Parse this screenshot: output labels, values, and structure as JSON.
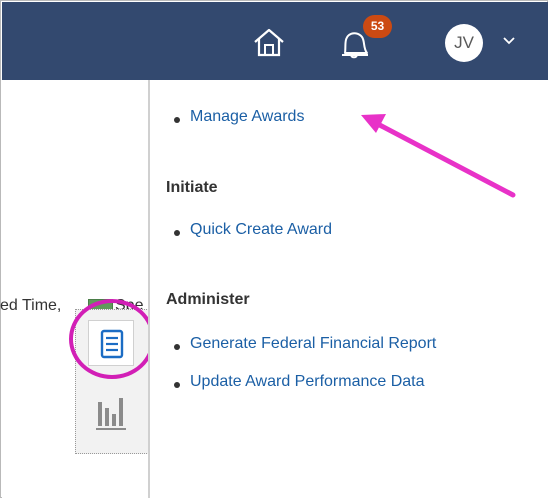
{
  "header": {
    "notification_count": "53",
    "avatar_initials": "JV"
  },
  "left_pane": {
    "legend_text_a": "ed Time,",
    "legend_text_b": "Spe",
    "legend_swatch_color": "#5f9a5b"
  },
  "menu": {
    "top_item": "Manage Awards",
    "sections": [
      {
        "title": "Initiate",
        "items": [
          "Quick Create Award"
        ]
      },
      {
        "title": "Administer",
        "items": [
          "Generate Federal Financial Report",
          "Update Award Performance Data"
        ]
      }
    ]
  },
  "colors": {
    "header_bg": "#33496f",
    "badge_bg": "#cc4a12",
    "link": "#1b5fa5",
    "annotation": "#e832c8",
    "highlight_ring": "#d21fb6"
  },
  "icons": {
    "home": "home-icon",
    "notifications": "bell-icon",
    "avatar_menu": "chevron-down-icon",
    "document": "document-icon",
    "chart": "bar-chart-icon",
    "annotation": "arrow-annotation-icon"
  }
}
